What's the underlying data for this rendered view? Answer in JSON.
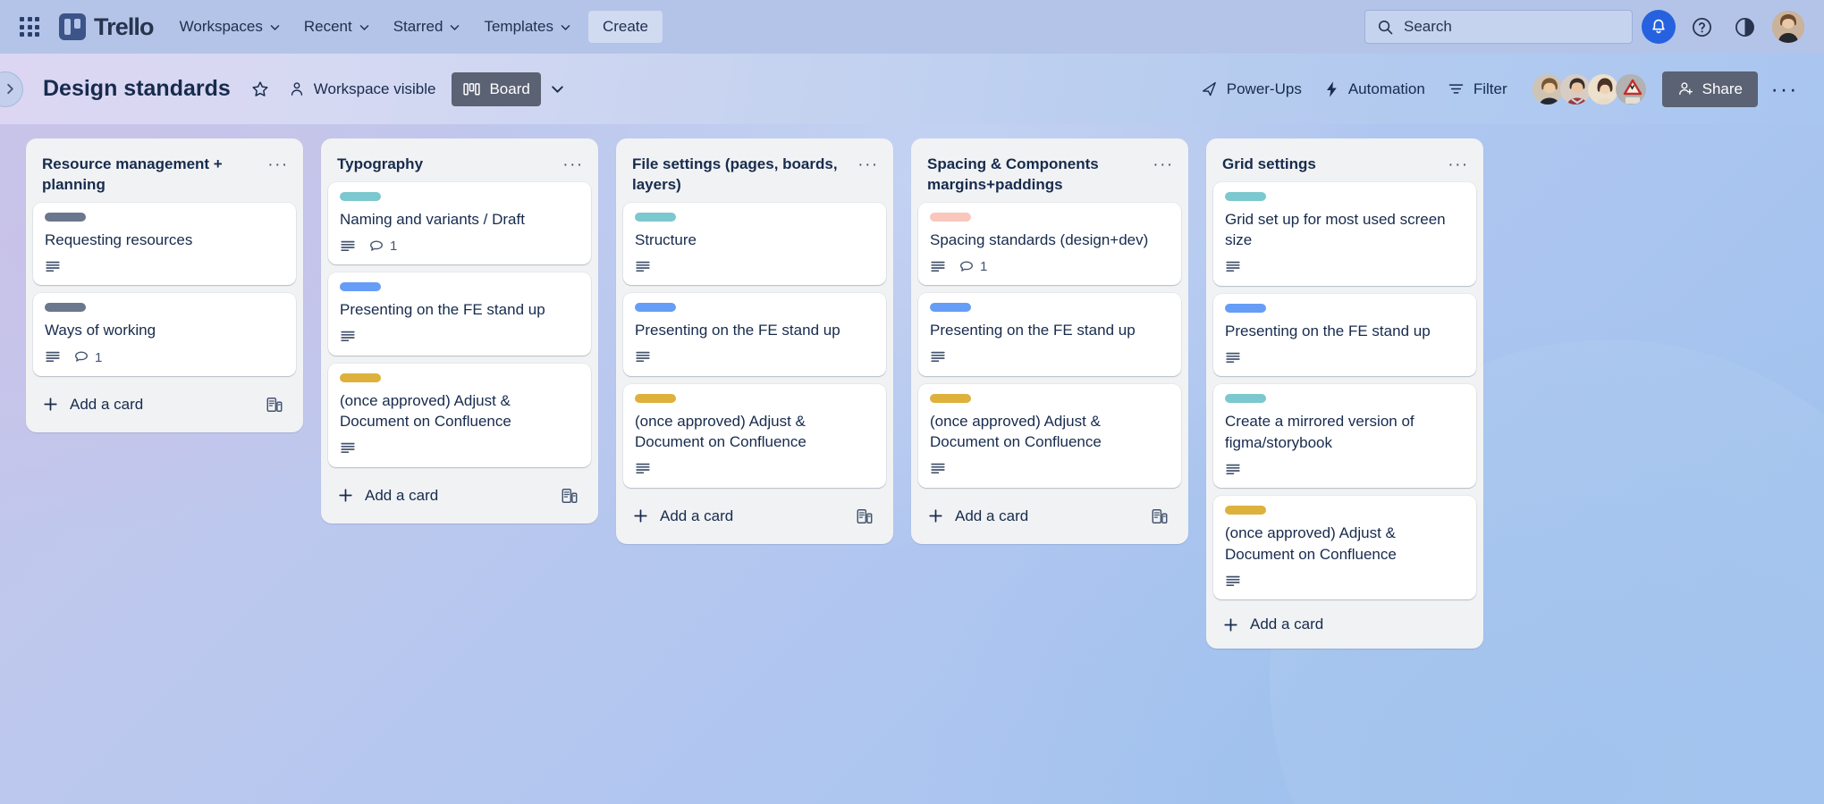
{
  "topnav": {
    "waffle_label": "apps-grid",
    "brand": "Trello",
    "items": [
      {
        "label": "Workspaces",
        "caret": true
      },
      {
        "label": "Recent",
        "caret": true
      },
      {
        "label": "Starred",
        "caret": true
      },
      {
        "label": "Templates",
        "caret": true
      }
    ],
    "create_label": "Create",
    "search": {
      "placeholder": "Search",
      "value": ""
    },
    "bell_color": "#2662E0",
    "background": "#B3C4E8"
  },
  "board_header": {
    "title": "Design standards",
    "visibility_label": "Workspace visible",
    "view_label": "Board",
    "powerups_label": "Power-Ups",
    "automation_label": "Automation",
    "filter_label": "Filter",
    "share_label": "Share",
    "members": [
      {
        "name": "member-1",
        "color": "#C9A88E"
      },
      {
        "name": "member-2",
        "color": "#8C5A52"
      },
      {
        "name": "member-3",
        "color": "#E8D6B8"
      },
      {
        "name": "member-4",
        "color": "#A9A9A9"
      }
    ]
  },
  "labels": {
    "grey": "#6B778C",
    "teal": "#7BC8CE",
    "blue": "#669DF6",
    "yellow": "#DDB13B",
    "pink": "#FAC7BC"
  },
  "add_card_label": "Add a card",
  "lists": [
    {
      "title": "Resource management + planning",
      "cards": [
        {
          "label_color": "grey",
          "title": "Requesting resources",
          "has_description": true,
          "comments": null
        },
        {
          "label_color": "grey",
          "title": "Ways of working",
          "has_description": true,
          "comments": "1"
        }
      ],
      "show_template_icon": true
    },
    {
      "title": "Typography",
      "cards": [
        {
          "label_color": "teal",
          "title": "Naming and variants / Draft",
          "has_description": true,
          "comments": "1"
        },
        {
          "label_color": "blue",
          "title": "Presenting on the FE stand up",
          "has_description": true,
          "comments": null
        },
        {
          "label_color": "yellow",
          "title": "(once approved) Adjust & Document on Confluence",
          "has_description": true,
          "comments": null
        }
      ],
      "show_template_icon": true
    },
    {
      "title": "File settings (pages, boards, layers)",
      "cards": [
        {
          "label_color": "teal",
          "title": "Structure",
          "has_description": true,
          "comments": null
        },
        {
          "label_color": "blue",
          "title": "Presenting on the FE stand up",
          "has_description": true,
          "comments": null
        },
        {
          "label_color": "yellow",
          "title": "(once approved) Adjust & Document on Confluence",
          "has_description": true,
          "comments": null
        }
      ],
      "show_template_icon": true
    },
    {
      "title": "Spacing & Components margins+paddings",
      "cards": [
        {
          "label_color": "pink",
          "title": "Spacing standards (design+dev)",
          "has_description": true,
          "comments": "1"
        },
        {
          "label_color": "blue",
          "title": "Presenting on the FE stand up",
          "has_description": true,
          "comments": null
        },
        {
          "label_color": "yellow",
          "title": "(once approved) Adjust & Document on Confluence",
          "has_description": true,
          "comments": null
        }
      ],
      "show_template_icon": true
    },
    {
      "title": "Grid settings",
      "cards": [
        {
          "label_color": "teal",
          "title": "Grid set up for most used screen size",
          "has_description": true,
          "comments": null
        },
        {
          "label_color": "blue",
          "title": "Presenting on the FE stand up",
          "has_description": true,
          "comments": null
        },
        {
          "label_color": "teal",
          "title": "Create a mirrored version of figma/storybook",
          "has_description": true,
          "comments": null
        },
        {
          "label_color": "yellow",
          "title": "(once approved) Adjust & Document on Confluence",
          "has_description": true,
          "comments": null
        }
      ],
      "show_template_icon": false
    }
  ]
}
